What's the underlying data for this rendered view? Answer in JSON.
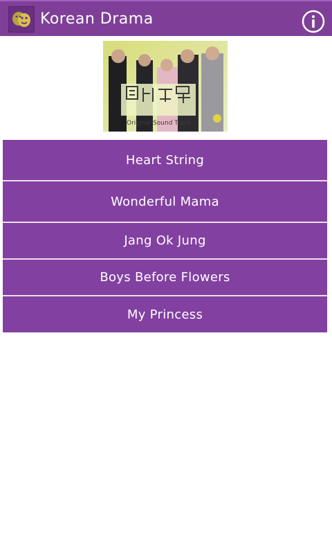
{
  "app_bar": {
    "title": "Korean Drama",
    "app_icon": "theater-masks-icon",
    "info_icon": "info-icon"
  },
  "cover": {
    "caption": "Original Sound Track"
  },
  "menu": {
    "items": [
      {
        "label": "Heart String"
      },
      {
        "label": "Wonderful Mama"
      },
      {
        "label": "Jang Ok Jung"
      },
      {
        "label": "Boys Before Flowers"
      },
      {
        "label": "My Princess"
      }
    ]
  },
  "colors": {
    "accent": "#7f3f98",
    "button": "#8240a0",
    "divider": "#eadff0",
    "background": "#ffffff"
  }
}
